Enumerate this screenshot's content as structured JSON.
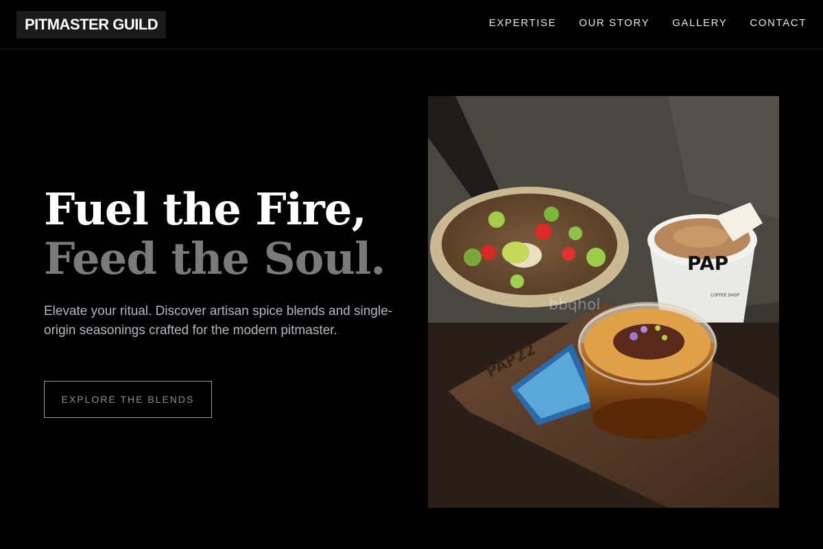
{
  "header": {
    "logo": "PITMASTER GUILD",
    "nav": [
      {
        "label": "EXPERTISE"
      },
      {
        "label": "OUR STORY"
      },
      {
        "label": "GALLERY"
      },
      {
        "label": "CONTACT"
      }
    ]
  },
  "hero": {
    "headline_line1": "Fuel the Fire,",
    "headline_line2": "Feed the Soul.",
    "subtext": "Elevate your ritual. Discover artisan spice blends and single-origin seasonings crafted for the modern pitmaster.",
    "cta_label": "EXPLORE THE BLENDS"
  },
  "photo": {
    "cup_brand": "PAP",
    "cup_sub": "COFFEE SHOP",
    "tray_engraving": "PAP22",
    "watermark": "bbqhol"
  },
  "colors": {
    "background": "#000000",
    "headline_primary": "#ffffff",
    "headline_secondary": "#7a7a7a",
    "body_text": "#b3b6bd"
  }
}
